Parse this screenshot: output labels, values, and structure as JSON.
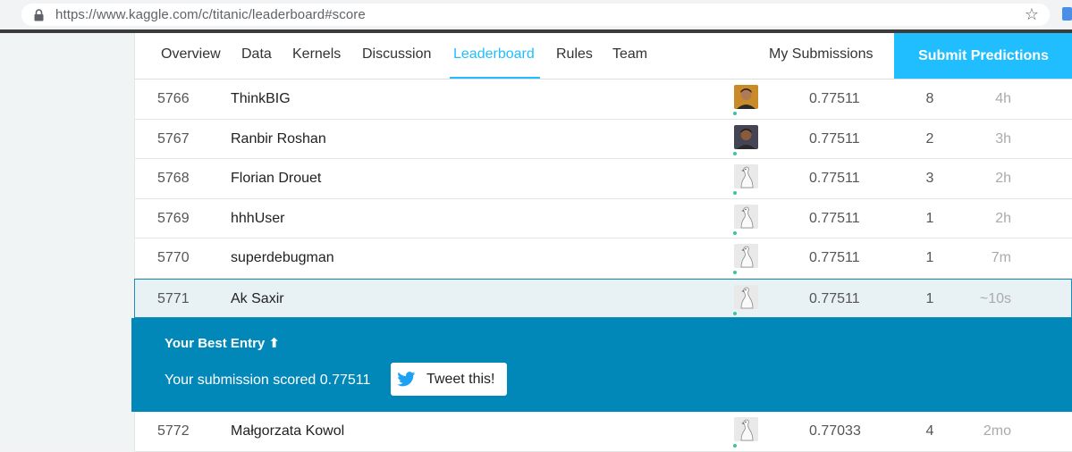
{
  "browser": {
    "url": "https://www.kaggle.com/c/titanic/leaderboard#score"
  },
  "tabs": [
    {
      "label": "Overview"
    },
    {
      "label": "Data"
    },
    {
      "label": "Kernels"
    },
    {
      "label": "Discussion"
    },
    {
      "label": "Leaderboard"
    },
    {
      "label": "Rules"
    },
    {
      "label": "Team"
    }
  ],
  "nav_right": {
    "my_submissions": "My Submissions",
    "submit_predictions": "Submit Predictions"
  },
  "leaderboard": {
    "rows_before": [
      {
        "rank": "5766",
        "name": "ThinkBIG",
        "avatar": "photo-avatar",
        "score": "0.77511",
        "entries": "8",
        "last": "4h"
      },
      {
        "rank": "5767",
        "name": "Ranbir Roshan",
        "avatar": "photo-avatar",
        "score": "0.77511",
        "entries": "2",
        "last": "3h"
      },
      {
        "rank": "5768",
        "name": "Florian Drouet",
        "avatar": "default-goose-avatar",
        "score": "0.77511",
        "entries": "3",
        "last": "2h"
      },
      {
        "rank": "5769",
        "name": "hhhUser",
        "avatar": "default-goose-avatar",
        "score": "0.77511",
        "entries": "1",
        "last": "2h"
      },
      {
        "rank": "5770",
        "name": "superdebugman",
        "avatar": "default-goose-avatar",
        "score": "0.77511",
        "entries": "1",
        "last": "7m"
      }
    ],
    "my_row": {
      "rank": "5771",
      "name": "Ak Saxir",
      "avatar": "default-goose-avatar",
      "score": "0.77511",
      "entries": "1",
      "last": "~10s"
    },
    "rows_after": [
      {
        "rank": "5772",
        "name": "Małgorzata Kowol",
        "avatar": "default-goose-avatar",
        "score": "0.77033",
        "entries": "4",
        "last": "2mo"
      }
    ]
  },
  "best_entry": {
    "title": "Your Best Entry ⬆",
    "message": "Your submission scored 0.77511",
    "tweet_label": "Tweet this!"
  },
  "colors": {
    "accent": "#20beff",
    "panel": "#0188b9",
    "highlight_row": "#e8f2f5",
    "online_dot": "#3cc3a3"
  }
}
